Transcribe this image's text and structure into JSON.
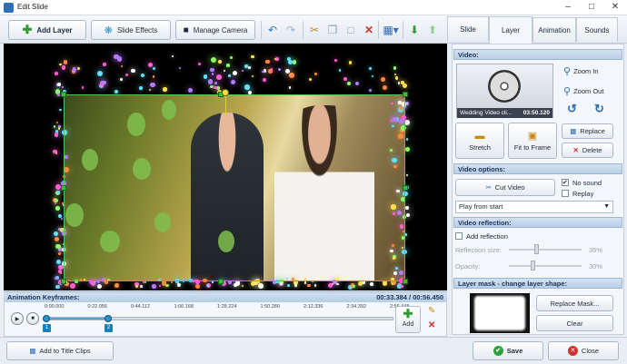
{
  "window": {
    "title": "Edit Slide",
    "controls": [
      "minimize",
      "maximize",
      "close"
    ]
  },
  "toolbar": {
    "add_layer": "Add Layer",
    "slide_effects": "Slide Effects",
    "manage_camera": "Manage Camera",
    "icons": [
      "undo-icon",
      "redo-icon",
      "cut-icon",
      "copy-icon",
      "paste-icon",
      "delete-icon",
      "grid-icon",
      "move-down-icon",
      "move-up-icon"
    ]
  },
  "keyframes": {
    "label": "Animation Keyframes:",
    "time": "00:33.384 / 00:56.450",
    "ticks": [
      "0:00.000",
      "0:22.056",
      "0:44.112",
      "1:06.168",
      "1:28.224",
      "1:50.280",
      "2:12.336",
      "2:34.392",
      "2:56.448"
    ],
    "markers": [
      "1",
      "2"
    ],
    "add_label": "Add"
  },
  "bottom": {
    "add_title_clips": "Add to Title Clips",
    "save": "Save",
    "close": "Close"
  },
  "tabs": [
    "Slide",
    "Layer",
    "Animation",
    "Sounds"
  ],
  "active_tab": "Layer",
  "video": {
    "header": "Video:",
    "clip_name": "Wedding Video cli...",
    "clip_duration": "03:50.120",
    "zoom_in": "Zoom In",
    "zoom_out": "Zoom Out",
    "stretch": "Stretch",
    "fit_to_frame": "Fit to Frame",
    "replace": "Replace",
    "delete": "Delete"
  },
  "video_options": {
    "header": "Video options:",
    "cut_video": "Cut Video",
    "no_sound": "No sound",
    "no_sound_checked": true,
    "replay": "Replay",
    "replay_checked": false,
    "play_mode": "Play from start"
  },
  "reflection": {
    "header": "Video reflection:",
    "add_reflection": "Add reflection",
    "size_label": "Reflection size:",
    "size_value": "35%",
    "size_fraction": 0.35,
    "opacity_label": "Opacity:",
    "opacity_value": "30%",
    "opacity_fraction": 0.3
  },
  "mask": {
    "header": "Layer mask - change layer shape:",
    "replace_mask": "Replace Mask...",
    "clear": "Clear"
  },
  "colors": {
    "accent": "#2f6fb3",
    "save_green": "#29a33a",
    "close_red": "#d0322d",
    "frame_green": "#55c15a"
  }
}
